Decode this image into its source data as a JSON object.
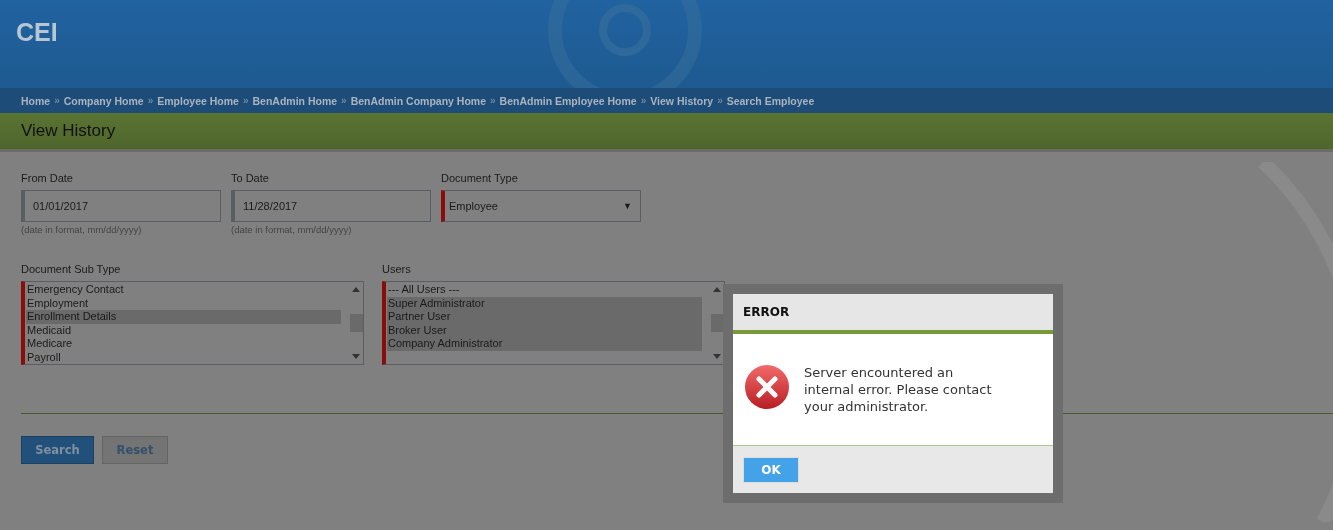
{
  "header": {
    "logo": "CEI"
  },
  "breadcrumbs": [
    "Home",
    "Company Home",
    "Employee Home",
    "BenAdmin Home",
    "BenAdmin Company Home",
    "BenAdmin Employee Home",
    "View History",
    "Search Employee"
  ],
  "breadcrumb_separator": "»",
  "page_title": "View History",
  "date_fields": [
    {
      "label": "From Date",
      "value": "01/01/2017",
      "hint": "(date in format, mm/dd/yyyy)"
    },
    {
      "label": "To Date",
      "value": "11/28/2017",
      "hint": "(date in format, mm/dd/yyyy)"
    }
  ],
  "document_type": {
    "label": "Document Type",
    "value": "Employee",
    "caret": "▼"
  },
  "lists": [
    {
      "label": "Document Sub Type",
      "items": [
        {
          "text": "Emergency Contact",
          "selected": false
        },
        {
          "text": "Employment",
          "selected": false
        },
        {
          "text": "Enrollment Details",
          "selected": true
        },
        {
          "text": "Medicaid",
          "selected": false
        },
        {
          "text": "Medicare",
          "selected": false
        },
        {
          "text": "Payroll",
          "selected": false
        }
      ]
    },
    {
      "label": "Users",
      "items": [
        {
          "text": "--- All Users ---",
          "selected": false
        },
        {
          "text": "Super Administrator",
          "selected": true
        },
        {
          "text": "Partner User",
          "selected": true
        },
        {
          "text": "Broker User",
          "selected": true
        },
        {
          "text": "Company Administrator",
          "selected": true
        }
      ]
    }
  ],
  "buttons": [
    "Search",
    "Reset"
  ],
  "dialog": {
    "title": "ERROR",
    "message": "Server encountered an internal error. Please contact your administrator.",
    "button": "OK"
  }
}
